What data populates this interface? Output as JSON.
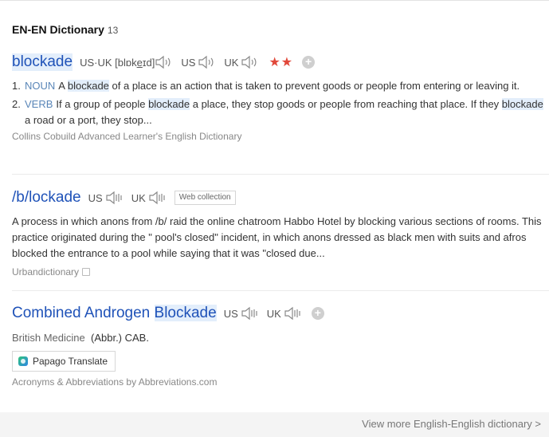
{
  "section": {
    "title": "EN-EN Dictionary",
    "count": "13"
  },
  "entry1": {
    "headword": "blockade",
    "pron_usuk_label": "US·UK",
    "ipa_pre": "[blɒk",
    "ipa_underlined": "e",
    "ipa_post": "ɪd]",
    "us_label": "US",
    "uk_label": "UK",
    "stars": "★★",
    "add_symbol": "+",
    "defs": [
      {
        "num": "1.",
        "pos": "NOUN",
        "pre": "A ",
        "hl": "blockade",
        "post": " of a place is an action that is taken to prevent goods or people from entering or leaving it."
      },
      {
        "num": "2.",
        "pos": "VERB",
        "pre": "If a group of people ",
        "hl": "blockade",
        "mid": " a place, they stop goods or people from reaching that place. If they ",
        "hl2": "blockade",
        "post": " a road or a port, they stop..."
      }
    ],
    "source": "Collins Cobuild Advanced Learner's English Dictionary"
  },
  "entry2": {
    "headword": "/b/lockade",
    "us_label": "US",
    "uk_label": "UK",
    "tag": "Web collection",
    "text": "A process in which anons from /b/ raid the online chatroom Habbo Hotel by blocking various sections of rooms. This practice originated during the \" pool's closed\" incident, in which anons dressed as black men with suits and afros blocked the entrance to a pool while saying that it was \"closed due...",
    "source": "Urbandictionary"
  },
  "entry3": {
    "headword_pre": "Combined Androgen ",
    "headword_hl": "Blockade",
    "us_label": "US",
    "uk_label": "UK",
    "add_symbol": "+",
    "field": "British Medicine",
    "abbr": "(Abbr.) CAB.",
    "papago_label": "Papago Translate",
    "source": "Acronyms & Abbreviations by Abbreviations.com"
  },
  "view_more": "View more English-English dictionary >",
  "icons": {
    "speaker": "speaker-icon",
    "papago": "papago-logo-icon",
    "copy": "copy-icon"
  },
  "colors": {
    "headword": "#1f52b8",
    "highlight": "#e3eefb",
    "stars": "#e1483a",
    "pos": "#5a86b8"
  }
}
